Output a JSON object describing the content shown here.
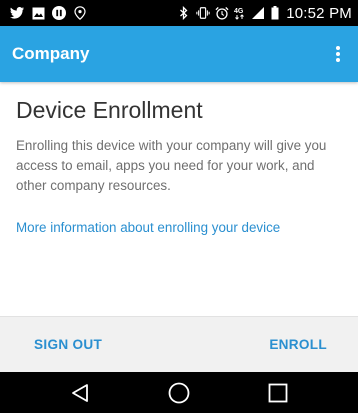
{
  "status_bar": {
    "time": "10:52 PM",
    "signal_label": "4G"
  },
  "app_bar": {
    "title": "Company"
  },
  "content": {
    "heading": "Device Enrollment",
    "body": "Enrolling this device with your company will give you access to email, apps you need for your work, and other company resources.",
    "link": "More information about enrolling your device"
  },
  "buttons": {
    "sign_out": "SIGN OUT",
    "enroll": "ENROLL"
  },
  "colors": {
    "accent": "#2aa3e2",
    "link": "#2a8fd0",
    "status_bar": "#000000"
  }
}
